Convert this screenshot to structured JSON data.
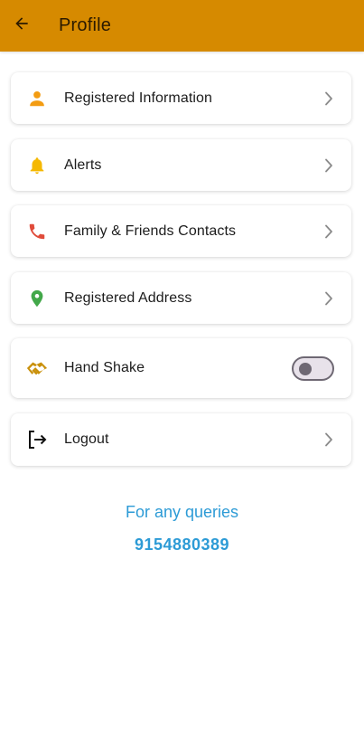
{
  "appbar": {
    "title": "Profile",
    "back_icon": "arrow-left-icon",
    "color": "#D68A00"
  },
  "menu": {
    "items": [
      {
        "label": "Registered Information",
        "icon": "person-icon",
        "icon_color": "#F39C12"
      },
      {
        "label": "Alerts",
        "icon": "bell-icon",
        "icon_color": "#F5B800"
      },
      {
        "label": "Family & Friends Contacts",
        "icon": "phone-icon",
        "icon_color": "#E04B3A"
      },
      {
        "label": "Registered Address",
        "icon": "location-pin-icon",
        "icon_color": "#43A84A"
      },
      {
        "label": "Hand Shake",
        "icon": "handshake-icon",
        "icon_color": "#C9900A",
        "toggle_on": false
      },
      {
        "label": "Logout",
        "icon": "logout-icon",
        "icon_color": "#111111"
      }
    ]
  },
  "footer": {
    "queries_text": "For any queries",
    "phone_number": "9154880389",
    "link_color": "#2D9BD6"
  }
}
